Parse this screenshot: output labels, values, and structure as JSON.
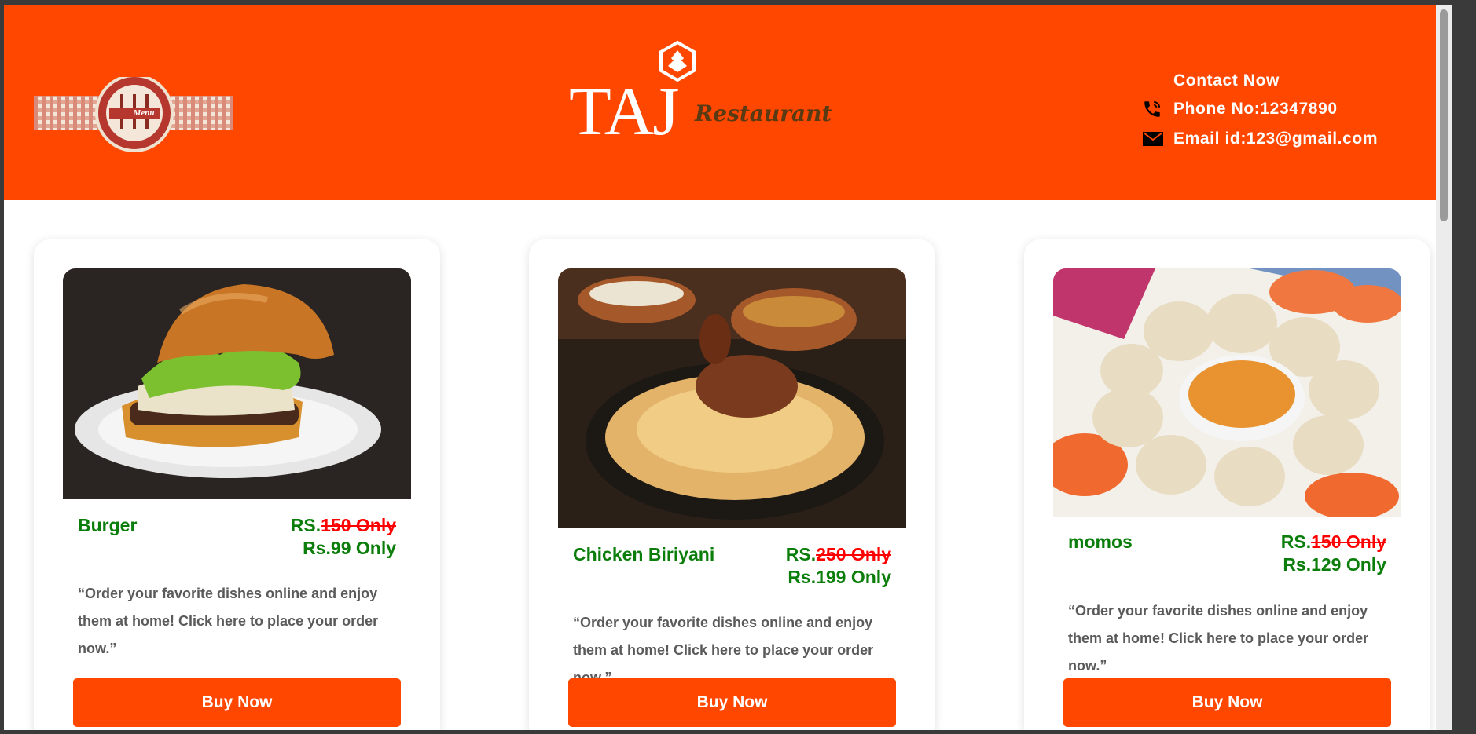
{
  "header": {
    "menu_badge_text": "Menu",
    "logo_main": "TAJ",
    "logo_sub": "Restaurant",
    "contact_title": "Contact Now",
    "phone": "Phone No:12347890",
    "email": "Email id:123@gmail.com"
  },
  "items": [
    {
      "name": "Burger",
      "price_prefix": "RS.",
      "old_price": "150 Only",
      "new_price": "Rs.99 Only",
      "description": "“Order your favorite dishes online and enjoy them at home! Click here to place your order now.”",
      "button": "Buy Now"
    },
    {
      "name": "Chicken Biriyani",
      "price_prefix": "RS.",
      "old_price": "250 Only",
      "new_price": "Rs.199 Only",
      "description": "“Order your favorite dishes online and enjoy them at home! Click here to place your order now.”",
      "button": "Buy Now"
    },
    {
      "name": "momos",
      "price_prefix": "RS.",
      "old_price": "150 Only",
      "new_price": "Rs.129 Only",
      "description": "“Order your favorite dishes online and enjoy them at home! Click here to place your order now.”",
      "button": "Buy Now"
    }
  ],
  "icons": {
    "phone": "phone-icon",
    "email": "email-icon",
    "menu_badge": "menu-badge-icon"
  },
  "colors": {
    "brand_orange": "#ff4700",
    "price_green": "#0a7d0a",
    "strike_red": "#ff0000"
  }
}
